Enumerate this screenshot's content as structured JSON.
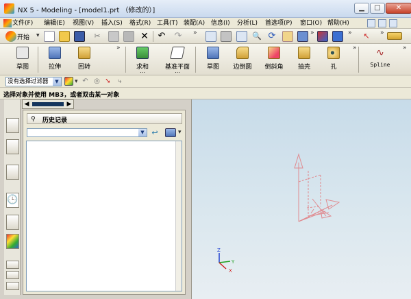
{
  "window": {
    "title": "NX 5 - Modeling - [model1.prt （修改的）]",
    "controls": {
      "minimize": "▁",
      "maximize": "□",
      "close": "✕"
    }
  },
  "menubar": {
    "items": [
      "文件(F)",
      "编辑(E)",
      "视图(V)",
      "插入(S)",
      "格式(R)",
      "工具(T)",
      "装配(A)",
      "信息(I)",
      "分析(L)",
      "首选项(P)",
      "窗口(O)",
      "帮助(H)"
    ]
  },
  "standard_toolbar": {
    "start_label": "开始"
  },
  "feature_toolbar": {
    "buttons": [
      "草图",
      "拉伸",
      "回转",
      "求和",
      "基准平面",
      "草图",
      "边倒圆",
      "倒斜角",
      "抽壳",
      "孔",
      "Spline"
    ]
  },
  "selection_filter": {
    "value": "没有选择过滤器"
  },
  "prompt": {
    "text": "选择对象并使用 MB3，或者双击某一对象"
  },
  "history_panel": {
    "title": "历史记录",
    "combo_value": "",
    "entries": []
  },
  "colors": {
    "viewport_top": "#c7dbe9",
    "viewport_bottom": "#e8eef2",
    "datum_csys": "#e07a80",
    "axis_x": "#d02020",
    "axis_y": "#20a020",
    "axis_z": "#2040d0"
  },
  "icons": [
    "app-logo-icon",
    "open-icon",
    "save-icon",
    "cut-icon",
    "copy-icon",
    "paste-icon",
    "delete-icon",
    "undo-icon",
    "redo-icon",
    "fit-icon",
    "zoom-icon",
    "rotate-icon",
    "sketch-icon",
    "extrude-icon",
    "revolve-icon",
    "unite-icon",
    "datum-plane-icon",
    "edge-blend-icon",
    "chamfer-icon",
    "shell-icon",
    "hole-icon",
    "spline-icon",
    "clock-icon",
    "pin-icon"
  ]
}
